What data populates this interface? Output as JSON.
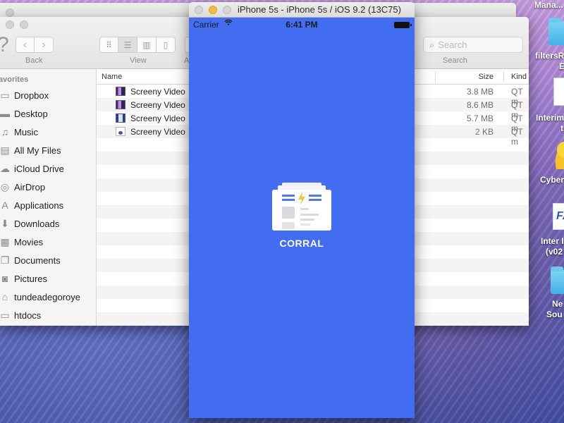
{
  "finder": {
    "toolbar": {
      "back_label": "Back",
      "view_label": "View",
      "arrange_label_partial": "A",
      "search_placeholder": "Search",
      "search_label": "Search"
    },
    "sidebar": {
      "heading": "Favorites",
      "heading_visible": "avorites",
      "items": [
        {
          "label": "Dropbox",
          "icon": "folder-icon"
        },
        {
          "label": "Desktop",
          "icon": "desktop-icon"
        },
        {
          "label": "Music",
          "icon": "music-icon"
        },
        {
          "label": "All My Files",
          "icon": "all-files-icon"
        },
        {
          "label": "iCloud Drive",
          "icon": "cloud-icon"
        },
        {
          "label": "AirDrop",
          "icon": "airdrop-icon"
        },
        {
          "label": "Applications",
          "icon": "applications-icon"
        },
        {
          "label": "Downloads",
          "icon": "downloads-icon"
        },
        {
          "label": "Movies",
          "icon": "movies-icon"
        },
        {
          "label": "Documents",
          "icon": "documents-icon"
        },
        {
          "label": "Pictures",
          "icon": "camera-icon"
        },
        {
          "label": "tundeadegoroye",
          "icon": "home-icon"
        },
        {
          "label": "htdocs",
          "icon": "folder-icon"
        }
      ]
    },
    "columns": {
      "name": "Name",
      "size": "Size",
      "kind": "Kind"
    },
    "files": [
      {
        "name": "Screeny Video",
        "size": "3.8 MB",
        "kind": "QT m",
        "icon": "video-icon"
      },
      {
        "name": "Screeny Video",
        "size": "8.6 MB",
        "kind": "QT m",
        "icon": "video-icon"
      },
      {
        "name": "Screeny Video",
        "size": "5.7 MB",
        "kind": "QT m",
        "icon": "video-icon"
      },
      {
        "name": "Screeny Video",
        "size": "2 KB",
        "kind": "QT m",
        "icon": "document-icon"
      }
    ]
  },
  "simulator": {
    "title": "iPhone 5s - iPhone 5s / iOS 9.2 (13C75)",
    "status": {
      "carrier": "Carrier",
      "time": "6:41 PM"
    },
    "app": {
      "name": "CORRAL",
      "background": "#436df0"
    }
  },
  "desktop": {
    "icons": [
      {
        "label": "Mana..."
      },
      {
        "label": "filtersR",
        "label2": "E"
      },
      {
        "label": "Interim",
        "label2": "t"
      },
      {
        "label": "Cyber"
      },
      {
        "label": "Inter I",
        "label2": "(v02"
      },
      {
        "label": "Ne",
        "label2": "Sou"
      }
    ]
  }
}
